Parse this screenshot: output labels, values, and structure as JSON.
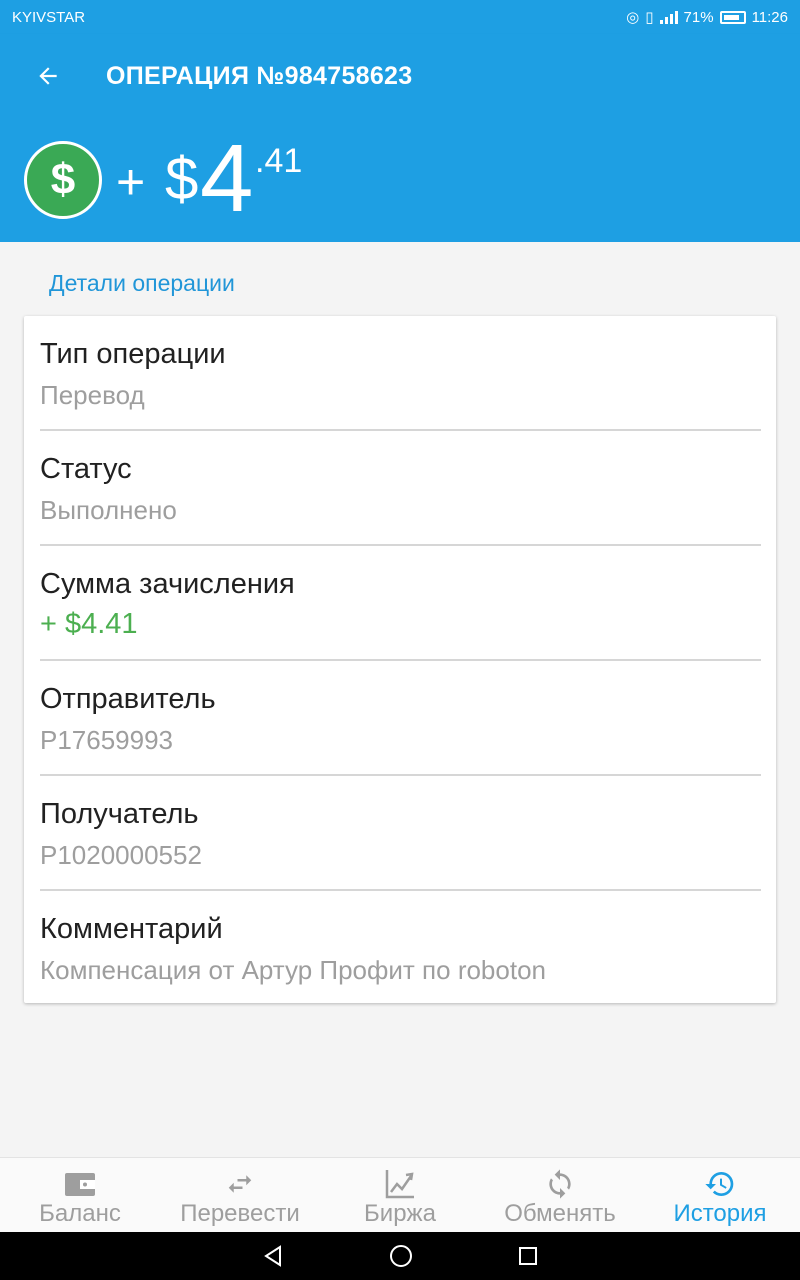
{
  "status_bar": {
    "carrier": "KYIVSTAR",
    "battery": "71%",
    "time": "11:26"
  },
  "app_bar": {
    "title": "ОПЕРАЦИЯ №984758623"
  },
  "amount": {
    "sign": "+",
    "currency": "$",
    "integer": "4",
    "fraction": ".41",
    "icon": "dollar-coin-icon"
  },
  "section_title": "Детали операции",
  "details": [
    {
      "label": "Тип операции",
      "value": "Перевод"
    },
    {
      "label": "Статус",
      "value": "Выполнено"
    },
    {
      "label": "Сумма зачисления",
      "value": "+ $4.41"
    },
    {
      "label": "Отправитель",
      "value": "P17659993"
    },
    {
      "label": "Получатель",
      "value": "P1020000552"
    },
    {
      "label": "Комментарий",
      "value": "Компенсация от Артур Профит по roboton"
    }
  ],
  "bottom_nav": [
    {
      "label": "Баланс",
      "icon": "wallet-icon"
    },
    {
      "label": "Перевести",
      "icon": "transfer-icon"
    },
    {
      "label": "Биржа",
      "icon": "chart-icon"
    },
    {
      "label": "Обменять",
      "icon": "exchange-icon"
    },
    {
      "label": "История",
      "icon": "history-icon",
      "active": true
    }
  ],
  "colors": {
    "primary": "#1e9fe3",
    "coin_green": "#3aa955",
    "credit_green": "#4caf50",
    "secondary_text": "#9e9e9e"
  }
}
